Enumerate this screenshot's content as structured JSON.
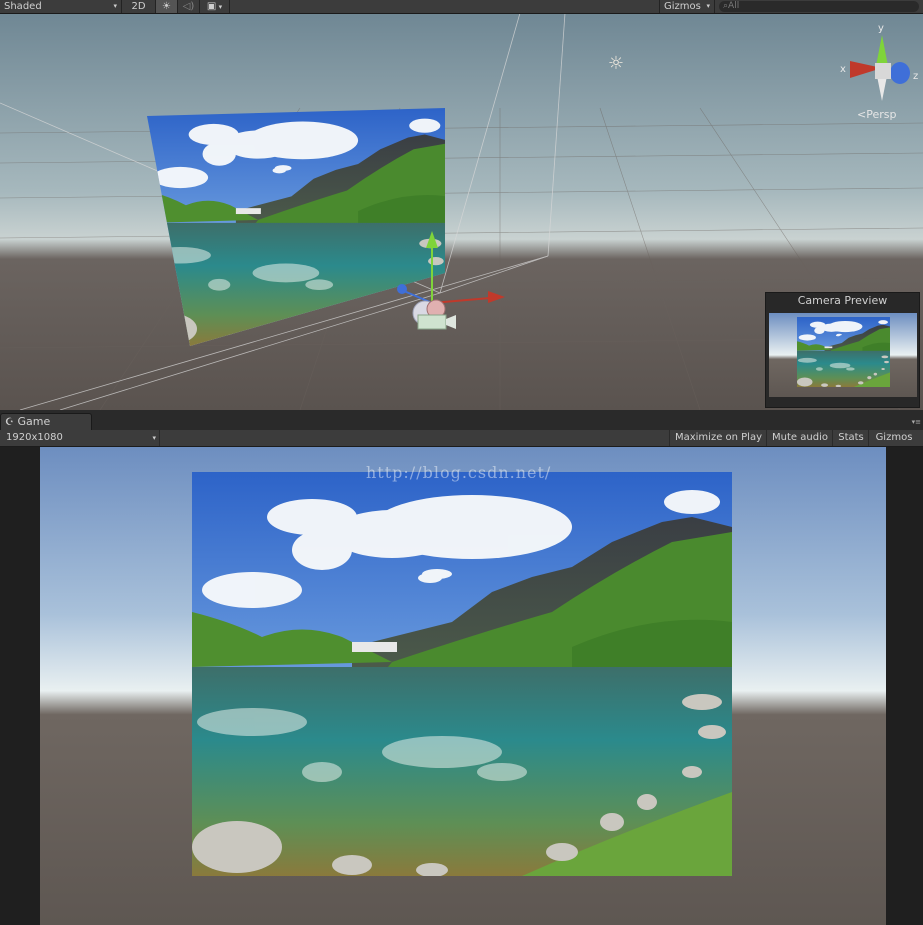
{
  "scene_toolbar": {
    "shading_mode": "Shaded",
    "mode_2d": "2D",
    "gizmos": "Gizmos",
    "search_placeholder": "All"
  },
  "scene_view": {
    "axis_labels": {
      "y": "y",
      "x": "x",
      "z": "z"
    },
    "projection": "Persp",
    "camera_preview_title": "Camera Preview"
  },
  "game_tab": {
    "label": "Game"
  },
  "game_toolbar": {
    "resolution": "1920x1080",
    "maximize_on_play": "Maximize on Play",
    "mute_audio": "Mute audio",
    "stats": "Stats",
    "gizmos": "Gizmos"
  },
  "watermark": "http://blog.csdn.net/",
  "colors": {
    "toolbar": "#3c3c3c",
    "panel_dark": "#1e1e1e",
    "axis_x": "#c0392b",
    "axis_y": "#7fd43a",
    "axis_z": "#3f6fd8"
  }
}
